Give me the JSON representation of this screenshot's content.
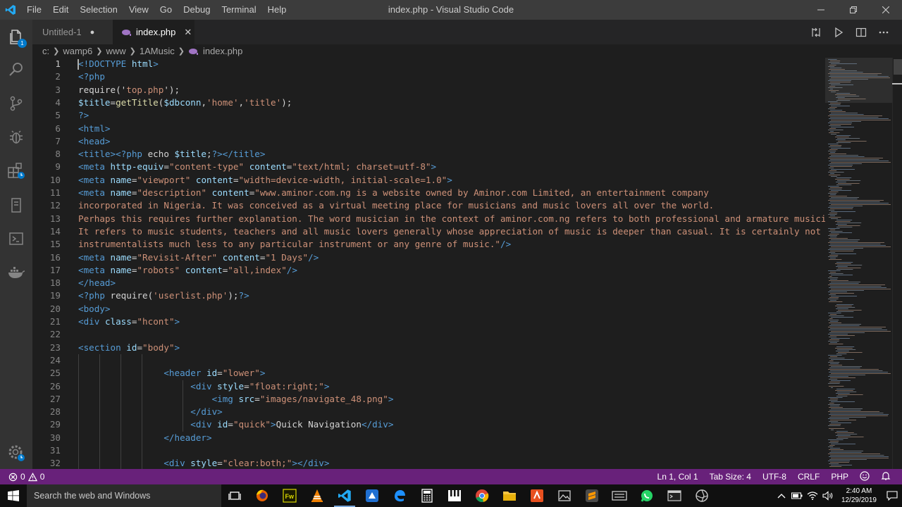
{
  "window": {
    "title": "index.php - Visual Studio Code",
    "menu": [
      "File",
      "Edit",
      "Selection",
      "View",
      "Go",
      "Debug",
      "Terminal",
      "Help"
    ]
  },
  "activity_bar": {
    "items": [
      "files-icon",
      "search-icon",
      "source-control-icon",
      "debug-icon",
      "extensions-icon",
      "remote-explorer-icon",
      "deploy-icon",
      "docker-icon"
    ],
    "explorer_badge": "1",
    "settings_icon": "gear-icon"
  },
  "tabs": [
    {
      "label": "Untitled-1",
      "modified_marker": "●",
      "active": false
    },
    {
      "label": "index.php",
      "close": "✕",
      "active": true
    }
  ],
  "breadcrumb": [
    "c:",
    "wamp6",
    "www",
    "1AMusic",
    "index.php"
  ],
  "editor": {
    "active_line": 1,
    "lines": [
      {
        "n": "1",
        "segs": [
          [
            "tag",
            "<!DOCTYPE"
          ],
          [
            "txt",
            " "
          ],
          [
            "attr",
            "html"
          ],
          [
            "tag",
            ">"
          ]
        ]
      },
      {
        "n": "2",
        "segs": [
          [
            "tag",
            "<?php"
          ]
        ]
      },
      {
        "n": "3",
        "segs": [
          [
            "txt",
            "require('"
          ],
          [
            "str",
            "top.php"
          ],
          [
            "txt",
            "');"
          ]
        ]
      },
      {
        "n": "4",
        "segs": [
          [
            "var",
            "$title"
          ],
          [
            "txt",
            "="
          ],
          [
            "fn",
            "getTitle"
          ],
          [
            "txt",
            "("
          ],
          [
            "var",
            "$dbconn"
          ],
          [
            "txt",
            ","
          ],
          [
            "str",
            "'home'"
          ],
          [
            "txt",
            ","
          ],
          [
            "str",
            "'title'"
          ],
          [
            "txt",
            ");"
          ]
        ]
      },
      {
        "n": "5",
        "segs": [
          [
            "tag",
            "?>"
          ]
        ]
      },
      {
        "n": "6",
        "segs": [
          [
            "tag",
            "<html>"
          ]
        ]
      },
      {
        "n": "7",
        "segs": [
          [
            "tag",
            "<head>"
          ]
        ]
      },
      {
        "n": "8",
        "segs": [
          [
            "tag",
            "<title>"
          ],
          [
            "tag",
            "<?php"
          ],
          [
            "txt",
            " echo "
          ],
          [
            "var",
            "$title"
          ],
          [
            "txt",
            ";"
          ],
          [
            "tag",
            "?>"
          ],
          [
            "tag",
            "</title>"
          ]
        ]
      },
      {
        "n": "9",
        "segs": [
          [
            "tag",
            "<meta"
          ],
          [
            "txt",
            " "
          ],
          [
            "attr",
            "http-equiv"
          ],
          [
            "txt",
            "="
          ],
          [
            "str",
            "\"content-type\""
          ],
          [
            "txt",
            " "
          ],
          [
            "attr",
            "content"
          ],
          [
            "txt",
            "="
          ],
          [
            "str",
            "\"text/html; charset=utf-8\""
          ],
          [
            "tag",
            ">"
          ]
        ]
      },
      {
        "n": "10",
        "segs": [
          [
            "tag",
            "<meta"
          ],
          [
            "txt",
            " "
          ],
          [
            "attr",
            "name"
          ],
          [
            "txt",
            "="
          ],
          [
            "str",
            "\"viewport\""
          ],
          [
            "txt",
            " "
          ],
          [
            "attr",
            "content"
          ],
          [
            "txt",
            "="
          ],
          [
            "str",
            "\"width=device-width, initial-scale=1.0\""
          ],
          [
            "tag",
            ">"
          ]
        ]
      },
      {
        "n": "11",
        "segs": [
          [
            "tag",
            "<meta"
          ],
          [
            "txt",
            " "
          ],
          [
            "attr",
            "name"
          ],
          [
            "txt",
            "="
          ],
          [
            "str",
            "\"description\""
          ],
          [
            "txt",
            " "
          ],
          [
            "attr",
            "content"
          ],
          [
            "txt",
            "="
          ],
          [
            "str",
            "\"www.aminor.com.ng is a website owned by Aminor.com Limited, an entertainment company"
          ]
        ]
      },
      {
        "n": "12",
        "segs": [
          [
            "str",
            "incorporated in Nigeria. It was conceived as a virtual meeting place for musicians and music lovers all over the world."
          ]
        ]
      },
      {
        "n": "13",
        "segs": [
          [
            "str",
            "Perhaps this requires further explanation. The word musician in the context of aminor.com.ng refers to both professional and armature musicians."
          ]
        ]
      },
      {
        "n": "14",
        "segs": [
          [
            "str",
            "It refers to music students, teachers and all music lovers generally whose appreciation of music is deeper than casual. It is certainly not limi"
          ]
        ]
      },
      {
        "n": "15",
        "segs": [
          [
            "str",
            "instrumentalists much less to any particular instrument or any genre of music.\""
          ],
          [
            "tag",
            "/>"
          ]
        ]
      },
      {
        "n": "16",
        "segs": [
          [
            "tag",
            "<meta"
          ],
          [
            "txt",
            " "
          ],
          [
            "attr",
            "name"
          ],
          [
            "txt",
            "="
          ],
          [
            "str",
            "\"Revisit-After\""
          ],
          [
            "txt",
            " "
          ],
          [
            "attr",
            "content"
          ],
          [
            "txt",
            "="
          ],
          [
            "str",
            "\"1 Days\""
          ],
          [
            "tag",
            "/>"
          ]
        ]
      },
      {
        "n": "17",
        "segs": [
          [
            "tag",
            "<meta"
          ],
          [
            "txt",
            " "
          ],
          [
            "attr",
            "name"
          ],
          [
            "txt",
            "="
          ],
          [
            "str",
            "\"robots\""
          ],
          [
            "txt",
            " "
          ],
          [
            "attr",
            "content"
          ],
          [
            "txt",
            "="
          ],
          [
            "str",
            "\"all,index\""
          ],
          [
            "tag",
            "/>"
          ]
        ]
      },
      {
        "n": "18",
        "segs": [
          [
            "tag",
            "</head>"
          ]
        ]
      },
      {
        "n": "19",
        "segs": [
          [
            "tag",
            "<?php"
          ],
          [
            "txt",
            " require("
          ],
          [
            "str",
            "'userlist.php'"
          ],
          [
            "txt",
            ");"
          ],
          [
            "tag",
            "?>"
          ]
        ]
      },
      {
        "n": "20",
        "segs": [
          [
            "tag",
            "<body>"
          ]
        ]
      },
      {
        "n": "21",
        "segs": [
          [
            "tag",
            "<div"
          ],
          [
            "txt",
            " "
          ],
          [
            "attr",
            "class"
          ],
          [
            "txt",
            "="
          ],
          [
            "str",
            "\"hcont\""
          ],
          [
            "tag",
            ">"
          ]
        ]
      },
      {
        "n": "22",
        "segs": []
      },
      {
        "n": "23",
        "segs": [
          [
            "tag",
            "<section"
          ],
          [
            "txt",
            " "
          ],
          [
            "attr",
            "id"
          ],
          [
            "txt",
            "="
          ],
          [
            "str",
            "\"body\""
          ],
          [
            "tag",
            ">"
          ]
        ]
      },
      {
        "n": "24",
        "segs": []
      },
      {
        "n": "25",
        "segs": [
          [
            "txt",
            "                "
          ],
          [
            "tag",
            "<header"
          ],
          [
            "txt",
            " "
          ],
          [
            "attr",
            "id"
          ],
          [
            "txt",
            "="
          ],
          [
            "str",
            "\"lower\""
          ],
          [
            "tag",
            ">"
          ]
        ]
      },
      {
        "n": "26",
        "segs": [
          [
            "txt",
            "                     "
          ],
          [
            "tag",
            "<div"
          ],
          [
            "txt",
            " "
          ],
          [
            "attr",
            "style"
          ],
          [
            "txt",
            "="
          ],
          [
            "str",
            "\"float:right;\""
          ],
          [
            "tag",
            ">"
          ]
        ]
      },
      {
        "n": "27",
        "segs": [
          [
            "txt",
            "                         "
          ],
          [
            "tag",
            "<img"
          ],
          [
            "txt",
            " "
          ],
          [
            "attr",
            "src"
          ],
          [
            "txt",
            "="
          ],
          [
            "str",
            "\"images/navigate_48.png\""
          ],
          [
            "tag",
            ">"
          ]
        ]
      },
      {
        "n": "28",
        "segs": [
          [
            "txt",
            "                     "
          ],
          [
            "tag",
            "</div>"
          ]
        ]
      },
      {
        "n": "29",
        "segs": [
          [
            "txt",
            "                     "
          ],
          [
            "tag",
            "<div"
          ],
          [
            "txt",
            " "
          ],
          [
            "attr",
            "id"
          ],
          [
            "txt",
            "="
          ],
          [
            "str",
            "\"quick\""
          ],
          [
            "tag",
            ">"
          ],
          [
            "txt",
            "Quick Navigation"
          ],
          [
            "tag",
            "</div>"
          ]
        ]
      },
      {
        "n": "30",
        "segs": [
          [
            "txt",
            "                "
          ],
          [
            "tag",
            "</header>"
          ]
        ]
      },
      {
        "n": "31",
        "segs": []
      },
      {
        "n": "32",
        "segs": [
          [
            "txt",
            "                "
          ],
          [
            "tag",
            "<div"
          ],
          [
            "txt",
            " "
          ],
          [
            "attr",
            "style"
          ],
          [
            "txt",
            "="
          ],
          [
            "str",
            "\"clear:both;\""
          ],
          [
            "tag",
            ">"
          ],
          [
            "tag",
            "</div>"
          ]
        ]
      }
    ]
  },
  "status_bar": {
    "errors": "0",
    "warnings": "0",
    "position": "Ln 1, Col 1",
    "tab_size": "Tab Size: 4",
    "encoding": "UTF-8",
    "eol": "CRLF",
    "language": "PHP",
    "color": "#68217a"
  },
  "taskbar": {
    "search_placeholder": "Search the web and Windows",
    "apps": [
      "task-view-icon",
      "firefox-icon",
      "fireworks-icon",
      "vlc-icon",
      "vscode-icon",
      "app-icon",
      "edge-icon",
      "calculator-icon",
      "piano-icon",
      "chrome-icon",
      "file-explorer-icon",
      "app-icon",
      "sublime-icon",
      "photos-icon",
      "whatsapp-icon",
      "terminal-icon",
      "app-icon"
    ],
    "time": "2:40 AM",
    "date": "12/29/2019"
  }
}
